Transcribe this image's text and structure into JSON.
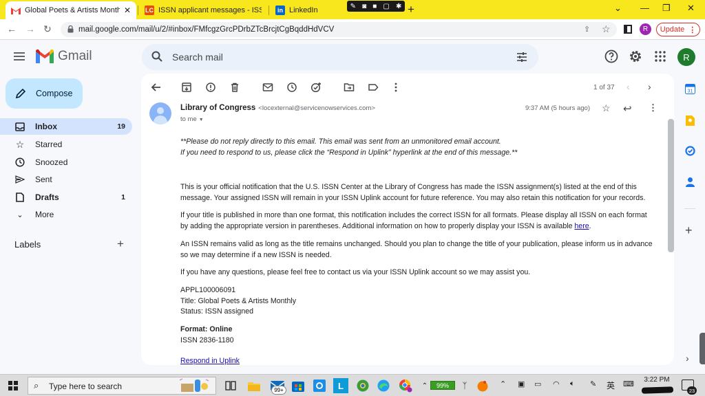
{
  "browser": {
    "tabs": [
      {
        "title": "Global Poets & Artists Monthly -",
        "close": "✕"
      },
      {
        "title": "ISSN applicant messages - ISSN"
      },
      {
        "title": "LinkedIn"
      }
    ],
    "url": "mail.google.com/mail/u/2/#inbox/FMfcgzGrcPDrbZTcBrcjtCgBqddHdVCV",
    "profile_initial": "R",
    "update_label": "Update"
  },
  "gmail": {
    "logo_text": "Gmail",
    "search_placeholder": "Search mail",
    "account_initial": "R",
    "compose_label": "Compose",
    "nav": [
      {
        "label": "Inbox",
        "count": "19"
      },
      {
        "label": "Starred"
      },
      {
        "label": "Snoozed"
      },
      {
        "label": "Sent"
      },
      {
        "label": "Drafts",
        "count": "1"
      },
      {
        "label": "More"
      }
    ],
    "labels_header": "Labels",
    "pager": "1 of 37"
  },
  "message": {
    "sender_name": "Library of Congress",
    "sender_email": "<locexternal@servicenowservices.com>",
    "to": "to me",
    "time": "9:37 AM (5 hours ago)",
    "body": {
      "notice_1": "**Please do not reply directly to this email. This email was sent from an unmonitored email account.",
      "notice_2": "If you need to respond to us, please click the “Respond in Uplink” hyperlink at the end of this message.**",
      "para_1": "This is your official notification that the U.S. ISSN Center at the Library of Congress has made the ISSN assignment(s) listed at the end of this message. Your assigned ISSN will remain in your ISSN Uplink account for future reference. You may also retain this notification for your records.",
      "para_2": "If your title is published in more than one format, this notification includes the correct ISSN for all formats. Please display all ISSN on each format by adding the appropriate version in parentheses. Additional information on how to properly display your ISSN is available ",
      "para_2_link": "here",
      "para_2_end": ".",
      "para_3": "An ISSN remains valid as long as the title remains unchanged. Should you plan to change the title of your publication, please inform us in advance so we may determine if a new ISSN is needed.",
      "para_4": "If you have any questions, please feel free to contact us via your ISSN Uplink account so we may assist you.",
      "appl_id": "APPL100006091",
      "title_line": "Title: Global Poets & Artists Monthly",
      "status_line": "Status: ISSN assigned",
      "format_line": "Format: Online",
      "issn_line": "ISSN 2836-1180",
      "respond_link": "Respond in Uplink"
    }
  },
  "taskbar": {
    "search_placeholder": "Type here to search",
    "mail_badge": "99+",
    "battery": "99%",
    "ime_label": "英",
    "time": "3:22 PM",
    "notifications": "23"
  }
}
